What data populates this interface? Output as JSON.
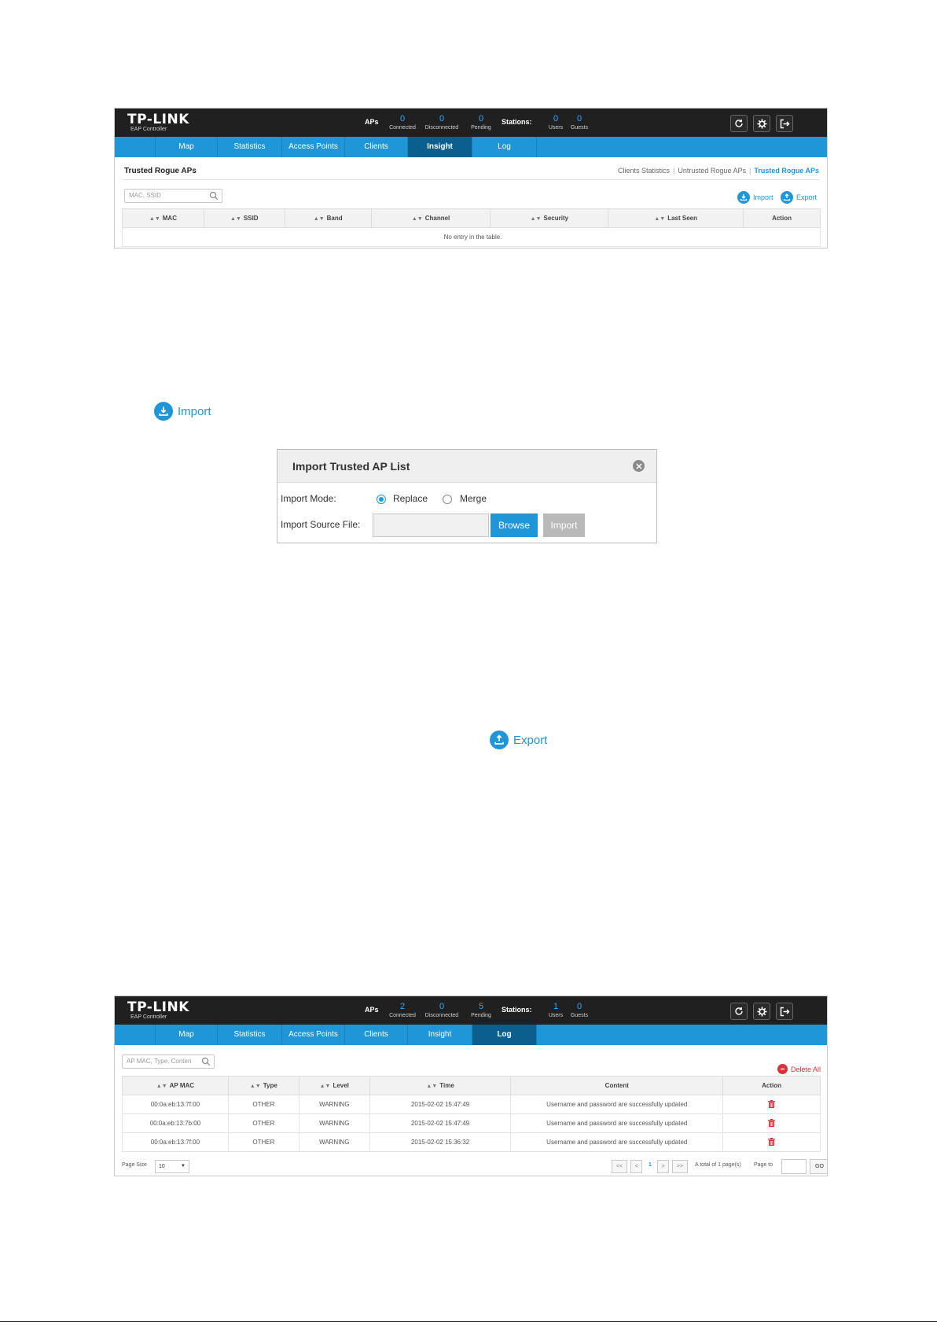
{
  "brand": {
    "name": "TP-LINK",
    "subtitle": "EAP Controller"
  },
  "screen1": {
    "aps_label": "APs",
    "aps": [
      {
        "value": "0",
        "caption": "Connected"
      },
      {
        "value": "0",
        "caption": "Disconnected"
      },
      {
        "value": "0",
        "caption": "Pending"
      }
    ],
    "stations_label": "Stations:",
    "stations": [
      {
        "value": "0",
        "caption": "Users"
      },
      {
        "value": "0",
        "caption": "Guests"
      }
    ],
    "nav": [
      "Map",
      "Statistics",
      "Access Points",
      "Clients",
      "Insight",
      "Log"
    ],
    "active_nav": "Insight",
    "section_title": "Trusted Rogue APs",
    "subnav": [
      "Clients Statistics",
      "Untrusted Rogue APs",
      "Trusted Rogue APs"
    ],
    "search_placeholder": "MAC, SSID",
    "import_label": "Import",
    "export_label": "Export",
    "columns": [
      "MAC",
      "SSID",
      "Band",
      "Channel",
      "Security",
      "Last Seen",
      "Action"
    ],
    "empty_text": "No entry in the table."
  },
  "standalone": {
    "import_label": "Import",
    "export_label": "Export"
  },
  "dialog": {
    "title": "Import Trusted AP List",
    "mode_label": "Import Mode:",
    "option_replace": "Replace",
    "option_merge": "Merge",
    "selected": "Replace",
    "file_label": "Import Source File:",
    "browse_label": "Browse",
    "import_label": "Import"
  },
  "screen2": {
    "aps_label": "APs",
    "aps": [
      {
        "value": "2",
        "caption": "Connected"
      },
      {
        "value": "0",
        "caption": "Disconnected"
      },
      {
        "value": "5",
        "caption": "Pending"
      }
    ],
    "stations_label": "Stations:",
    "stations": [
      {
        "value": "1",
        "caption": "Users"
      },
      {
        "value": "0",
        "caption": "Guests"
      }
    ],
    "nav": [
      "Map",
      "Statistics",
      "Access Points",
      "Clients",
      "Insight",
      "Log"
    ],
    "active_nav": "Log",
    "search_placeholder": "AP MAC, Type, Conten",
    "delete_all_label": "Delete All",
    "columns": [
      "AP MAC",
      "Type",
      "Level",
      "Time",
      "Content",
      "Action"
    ],
    "rows": [
      {
        "mac": "00:0a:eb:13:7f:00",
        "type": "OTHER",
        "level": "WARNING",
        "time": "2015-02-02 15:47:49",
        "content": "Username and password are successfully updated"
      },
      {
        "mac": "00:0a:eb:13:7b:00",
        "type": "OTHER",
        "level": "WARNING",
        "time": "2015-02-02 15:47:49",
        "content": "Username and password are successfully updated"
      },
      {
        "mac": "00:0a:eb:13:7f:00",
        "type": "OTHER",
        "level": "WARNING",
        "time": "2015-02-02 15:36:32",
        "content": "Username and password are successfully updated"
      }
    ],
    "page_size_label": "Page Size",
    "page_size": "10",
    "pager": {
      "first": "<<",
      "prev": "<",
      "current": "1",
      "next": ">",
      "last": ">>"
    },
    "total_text": "A total of 1 page(s)",
    "page_to_label": "Page to",
    "go_label": "GO"
  },
  "colors": {
    "accent": "#1f96d8",
    "topbar": "#202020",
    "nav_active": "#0b5f8e",
    "danger": "#d9323b"
  }
}
